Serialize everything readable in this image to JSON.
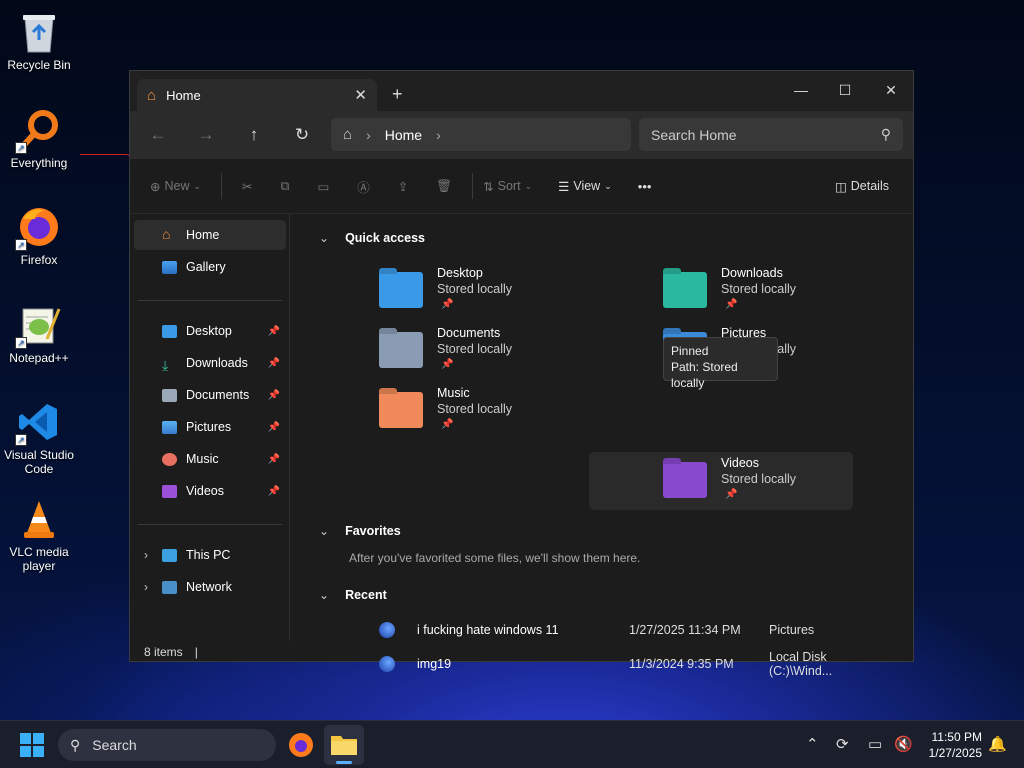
{
  "desktop": {
    "icons": [
      {
        "label": "Recycle Bin"
      },
      {
        "label": "Everything"
      },
      {
        "label": "Firefox"
      },
      {
        "label": "Notepad++"
      },
      {
        "label": "Visual Studio Code"
      },
      {
        "label": "VLC media player"
      }
    ]
  },
  "window": {
    "tab_title": "Home",
    "tab_close": "✕",
    "new_tab": "+",
    "controls": {
      "minimize": "—",
      "maximize": "☐",
      "close": "✕"
    },
    "address": {
      "crumb": "Home"
    },
    "search_placeholder": "Search Home",
    "toolbar": {
      "new": "New",
      "sort": "Sort",
      "view": "View",
      "more": "•••",
      "details": "Details"
    },
    "sidebar": {
      "top": [
        {
          "label": "Home"
        },
        {
          "label": "Gallery"
        }
      ],
      "pinned": [
        {
          "label": "Desktop"
        },
        {
          "label": "Downloads"
        },
        {
          "label": "Documents"
        },
        {
          "label": "Pictures"
        },
        {
          "label": "Music"
        },
        {
          "label": "Videos"
        }
      ],
      "devices": [
        {
          "label": "This PC"
        },
        {
          "label": "Network"
        }
      ]
    },
    "quick_access": {
      "header": "Quick access",
      "items": [
        {
          "name": "Desktop",
          "sub": "Stored locally"
        },
        {
          "name": "Downloads",
          "sub": "Stored locally"
        },
        {
          "name": "Documents",
          "sub": "Stored locally"
        },
        {
          "name": "Pictures",
          "sub": "Stored locally"
        },
        {
          "name": "Music",
          "sub": "Stored locally"
        },
        {
          "name": "Videos",
          "sub": "Stored locally"
        }
      ]
    },
    "tooltip": {
      "line1": "Pinned",
      "line2": "Path: Stored locally"
    },
    "favorites": {
      "header": "Favorites",
      "empty": "After you've favorited some files, we'll show them here."
    },
    "recent": {
      "header": "Recent",
      "rows": [
        {
          "name": "i fucking hate windows 11",
          "date": "1/27/2025 11:34 PM",
          "location": "Pictures"
        },
        {
          "name": "img19",
          "date": "11/3/2024 9:35 PM",
          "location": "Local Disk (C:)\\Wind..."
        }
      ]
    },
    "status": {
      "count": "8 items",
      "cursor": "|"
    }
  },
  "taskbar": {
    "search": "Search",
    "time": "11:50 PM",
    "date": "1/27/2025"
  }
}
